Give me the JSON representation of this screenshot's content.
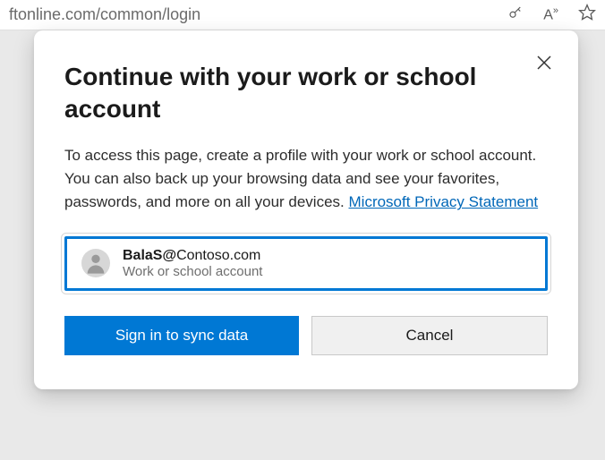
{
  "addressBar": {
    "url": "ftonline.com/common/login"
  },
  "dialog": {
    "title": "Continue with your work or school account",
    "body": "To access this page, create a profile with your work or school account. You can also back up your browsing data and see your favorites, passwords, and more on all your devices. ",
    "privacyLinkText": "Microsoft Privacy Statement",
    "account": {
      "emailPrefix": "BalaS@",
      "emailDomain": "Contoso.com",
      "type": "Work or school account"
    },
    "buttons": {
      "primary": "Sign in to sync data",
      "secondary": "Cancel"
    }
  }
}
